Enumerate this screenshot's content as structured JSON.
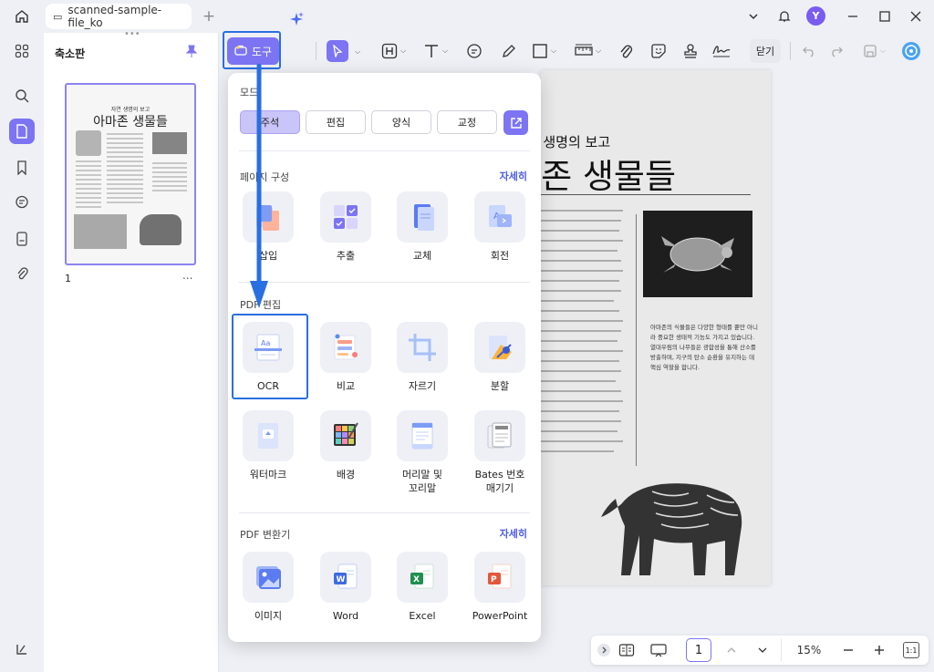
{
  "window": {
    "tab_title": "scanned-sample-file_ko",
    "new_tab": "+",
    "avatar_letter": "Y"
  },
  "panel": {
    "title": "축소판",
    "page_number": "1",
    "more": "...",
    "thumb_small_title": "자연 생명의 보고",
    "thumb_title": "아마존 생물들"
  },
  "toolbar": {
    "tools_label": "도구",
    "close_label": "닫기"
  },
  "menu": {
    "mode_title": "모드",
    "modes": [
      {
        "label": "주석",
        "active": true
      },
      {
        "label": "편집",
        "active": false
      },
      {
        "label": "양식",
        "active": false
      },
      {
        "label": "교정",
        "active": false
      }
    ],
    "page_section": {
      "title": "페이지 구성",
      "more": "자세히",
      "items": [
        "삽입",
        "추출",
        "교체",
        "회전"
      ]
    },
    "edit_section": {
      "title": "PDF 편집",
      "items": [
        "OCR",
        "비교",
        "자르기",
        "분할",
        "워터마크",
        "배경",
        "머리말 및\n꼬리말",
        "Bates 번호\n매기기"
      ]
    },
    "convert_section": {
      "title": "PDF 변환기",
      "more": "자세히",
      "items": [
        "이미지",
        "Word",
        "Excel",
        "PowerPoint"
      ]
    }
  },
  "document": {
    "subtitle": "자연 생명의 보고",
    "title": "아마존 생물들",
    "side_text": "아마존의 식물들은 다양한 형태를 뿐만 아니라 중요한 생태적 기능도 가지고 있습니다. 열대우림의 나무들은 광합성을 통해 산소를 방출하며, 지구의 탄소 순환을 유지하는 데 핵심 역할을 합니다."
  },
  "bottom": {
    "page_input": "1",
    "zoom": "15%",
    "fit_label": "1:1"
  },
  "colors": {
    "accent": "#7c74f3",
    "highlight": "#2a6fe0",
    "link": "#4b5de4"
  }
}
